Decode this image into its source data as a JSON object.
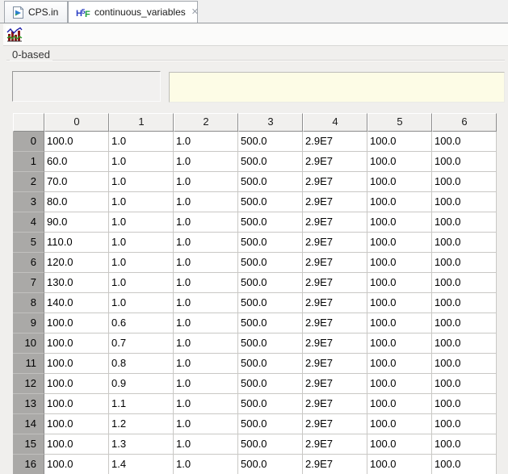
{
  "tabs": [
    {
      "label": "CPS.in"
    },
    {
      "label": "continuous_variables"
    }
  ],
  "icons": {
    "close": "✕",
    "tab_cps": "run-file-icon",
    "tab_cv": "hdf-file-icon",
    "toolbar_chart": "chart-icon"
  },
  "toolbar": {
    "chart_button_tooltip_visible": false
  },
  "panel": {
    "group_label": "0-based"
  },
  "fields": {
    "selection_value": "",
    "cell_value": ""
  },
  "colors": {
    "pane_bg": "#f0efed",
    "row_header_bg": "#aaa9a7",
    "column_header_bg": "#f1f0ee",
    "grid_line": "#c9c8c5",
    "value_field_bg": "#fdfce6",
    "tab_border": "#a2a7ad",
    "chart_bar_red": "#8b1a1a",
    "chart_line_blue": "#1a1aa6",
    "chart_line_green": "#2ca02c"
  },
  "table": {
    "corner": "",
    "columns": [
      "0",
      "1",
      "2",
      "3",
      "4",
      "5",
      "6"
    ],
    "rows": [
      {
        "header": "0",
        "cells": [
          "100.0",
          "1.0",
          "1.0",
          "500.0",
          "2.9E7",
          "100.0",
          "100.0"
        ]
      },
      {
        "header": "1",
        "cells": [
          "60.0",
          "1.0",
          "1.0",
          "500.0",
          "2.9E7",
          "100.0",
          "100.0"
        ]
      },
      {
        "header": "2",
        "cells": [
          "70.0",
          "1.0",
          "1.0",
          "500.0",
          "2.9E7",
          "100.0",
          "100.0"
        ]
      },
      {
        "header": "3",
        "cells": [
          "80.0",
          "1.0",
          "1.0",
          "500.0",
          "2.9E7",
          "100.0",
          "100.0"
        ]
      },
      {
        "header": "4",
        "cells": [
          "90.0",
          "1.0",
          "1.0",
          "500.0",
          "2.9E7",
          "100.0",
          "100.0"
        ]
      },
      {
        "header": "5",
        "cells": [
          "110.0",
          "1.0",
          "1.0",
          "500.0",
          "2.9E7",
          "100.0",
          "100.0"
        ]
      },
      {
        "header": "6",
        "cells": [
          "120.0",
          "1.0",
          "1.0",
          "500.0",
          "2.9E7",
          "100.0",
          "100.0"
        ]
      },
      {
        "header": "7",
        "cells": [
          "130.0",
          "1.0",
          "1.0",
          "500.0",
          "2.9E7",
          "100.0",
          "100.0"
        ]
      },
      {
        "header": "8",
        "cells": [
          "140.0",
          "1.0",
          "1.0",
          "500.0",
          "2.9E7",
          "100.0",
          "100.0"
        ]
      },
      {
        "header": "9",
        "cells": [
          "100.0",
          "0.6",
          "1.0",
          "500.0",
          "2.9E7",
          "100.0",
          "100.0"
        ]
      },
      {
        "header": "10",
        "cells": [
          "100.0",
          "0.7",
          "1.0",
          "500.0",
          "2.9E7",
          "100.0",
          "100.0"
        ]
      },
      {
        "header": "11",
        "cells": [
          "100.0",
          "0.8",
          "1.0",
          "500.0",
          "2.9E7",
          "100.0",
          "100.0"
        ]
      },
      {
        "header": "12",
        "cells": [
          "100.0",
          "0.9",
          "1.0",
          "500.0",
          "2.9E7",
          "100.0",
          "100.0"
        ]
      },
      {
        "header": "13",
        "cells": [
          "100.0",
          "1.1",
          "1.0",
          "500.0",
          "2.9E7",
          "100.0",
          "100.0"
        ]
      },
      {
        "header": "14",
        "cells": [
          "100.0",
          "1.2",
          "1.0",
          "500.0",
          "2.9E7",
          "100.0",
          "100.0"
        ]
      },
      {
        "header": "15",
        "cells": [
          "100.0",
          "1.3",
          "1.0",
          "500.0",
          "2.9E7",
          "100.0",
          "100.0"
        ]
      },
      {
        "header": "16",
        "cells": [
          "100.0",
          "1.4",
          "1.0",
          "500.0",
          "2.9E7",
          "100.0",
          "100.0"
        ]
      }
    ]
  }
}
